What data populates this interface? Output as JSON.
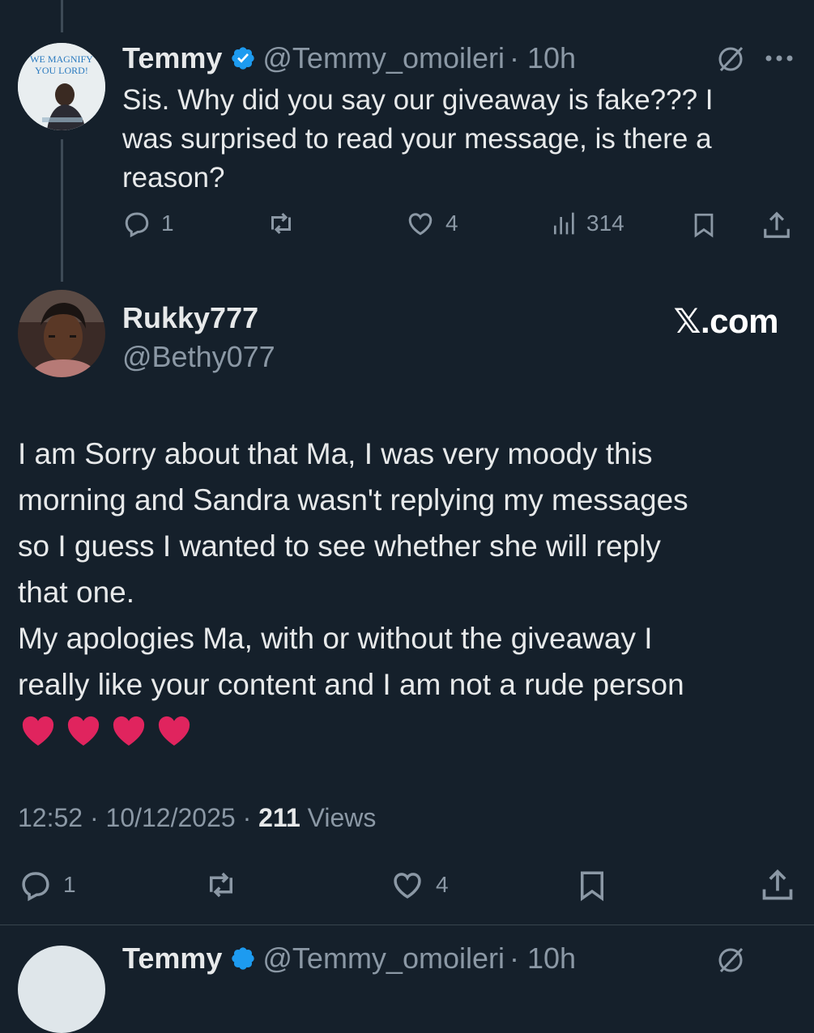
{
  "parent": {
    "name": "Temmy",
    "handle": "@Temmy_omoileri",
    "time": "· 10h",
    "text_lines": [
      "Sis. Why did you say our giveaway is fake??? I",
      "was surprised to read your message, is there a",
      "reason?"
    ],
    "avatar_text": [
      "WE MAGNIFY",
      "YOU LORD!"
    ],
    "replies": "1",
    "likes": "4",
    "views": "314"
  },
  "main": {
    "name": "Rukky777",
    "handle": "@Bethy077",
    "brand": "𝕏.com",
    "text_lines": [
      "I am Sorry about that Ma, I was very moody this",
      "morning and Sandra wasn't replying my messages",
      "so I guess I wanted to see whether she will reply",
      "that one.",
      "My apologies Ma, with or without the giveaway I",
      "really like your content and I am not a rude person"
    ],
    "hearts": [
      "❤️",
      "❤️",
      "❤️",
      "❤️"
    ],
    "timestamp": "12:52 · 10/12/2025 · ",
    "views_count": "211",
    "views_label": " Views",
    "replies": "1",
    "likes": "4"
  },
  "next": {
    "name": "Temmy",
    "handle": "@Temmy_omoileri",
    "time": "· 10h"
  },
  "colors": {
    "background": "#15202b",
    "text": "#e7e9ea",
    "muted": "#8b98a5",
    "verified": "#1d9bf0",
    "heart": "#e0245e"
  }
}
